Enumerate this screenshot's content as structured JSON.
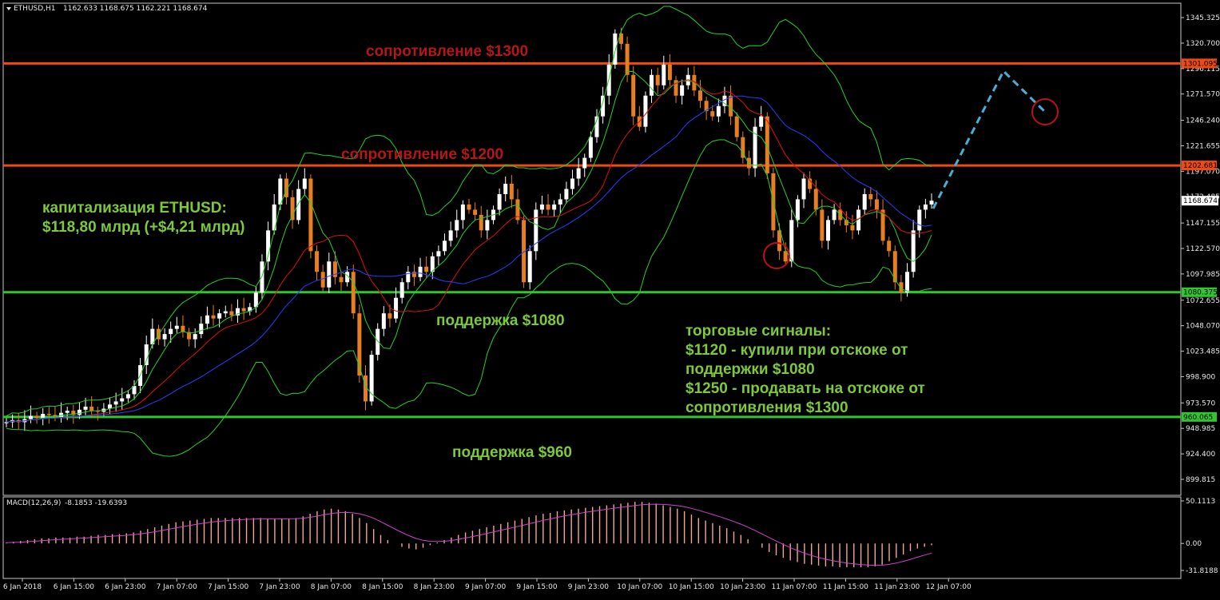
{
  "header": {
    "symbol": "ETHUSD,H1",
    "ohlc": "1162.633 1168.675 1162.221 1168.674",
    "macd_label": "MACD(12,26,9)",
    "macd_values": "-8.1853 -19.6393"
  },
  "colors": {
    "background": "#000000",
    "bull": "#ffffff",
    "bear": "#e67e22",
    "resistance": "#f04a0f",
    "support": "#31c531",
    "bollinger": "#22d322",
    "ma_fast": "#22d322",
    "ma_mid": "#e01010",
    "ma_slow": "#2a3cff",
    "projection": "#4aaed6",
    "macd_hist": "#f0a894",
    "macd_signal": "#d040d0"
  },
  "annotations": {
    "res1300": "сопротивление $1300",
    "res1200": "сопротивление $1200",
    "sup1080": "поддержка $1080",
    "sup960": "поддержка $960",
    "cap_line1": "капитализация ETHUSD:",
    "cap_line2": "$118,80 млрд (+$4,21 млрд)",
    "signals_title": "торговые сигналы:",
    "signal1_line1": "$1120 - купили при отскоке от",
    "signal1_line2": "поддержки $1080",
    "signal2_line1": "$1250 - продавать на отскоке от",
    "signal2_line2": "сопротивления $1300"
  },
  "chart_data": {
    "type": "candlestick",
    "title": "ETHUSD,H1",
    "y_ticks": [
      "1345.325",
      "1320.700",
      "1296.115",
      "1271.570",
      "1246.240",
      "1221.655",
      "1197.070",
      "1172.485",
      "1147.155",
      "1122.570",
      "1097.985",
      "1072.655",
      "1048.070",
      "1023.485",
      "998.900",
      "973.570",
      "948.985",
      "924.400",
      "899.815"
    ],
    "ylim": [
      899.815,
      1345.325
    ],
    "x_ticks": [
      "6 Jan 2018",
      "6 Jan 15:00",
      "6 Jan 23:00",
      "7 Jan 07:00",
      "7 Jan 15:00",
      "7 Jan 23:00",
      "8 Jan 07:00",
      "8 Jan 15:00",
      "8 Jan 23:00",
      "9 Jan 07:00",
      "9 Jan 15:00",
      "9 Jan 23:00",
      "10 Jan 07:00",
      "10 Jan 15:00",
      "10 Jan 23:00",
      "11 Jan 07:00",
      "11 Jan 15:00",
      "11 Jan 23:00",
      "12 Jan 07:00"
    ],
    "levels": [
      {
        "label": "1301.095",
        "value": 1301.095,
        "kind": "resistance"
      },
      {
        "label": "1202.681",
        "value": 1202.681,
        "kind": "resistance"
      },
      {
        "label": "1168.674",
        "value": 1168.674,
        "kind": "current"
      },
      {
        "label": "1080.375",
        "value": 1080.375,
        "kind": "support"
      },
      {
        "label": "960.065",
        "value": 960.065,
        "kind": "support"
      }
    ],
    "candles_close": [
      955,
      957,
      955,
      958,
      961,
      959,
      963,
      962,
      960,
      964,
      966,
      962,
      967,
      970,
      966,
      965,
      968,
      972,
      975,
      978,
      982,
      990,
      1010,
      1030,
      1045,
      1035,
      1040,
      1045,
      1048,
      1042,
      1035,
      1040,
      1050,
      1058,
      1055,
      1060,
      1062,
      1058,
      1065,
      1062,
      1066,
      1080,
      1110,
      1140,
      1165,
      1190,
      1172,
      1150,
      1180,
      1190,
      1120,
      1100,
      1085,
      1110,
      1095,
      1090,
      1100,
      1060,
      1000,
      975,
      1020,
      1045,
      1060,
      1055,
      1075,
      1090,
      1100,
      1095,
      1105,
      1100,
      1115,
      1120,
      1130,
      1140,
      1150,
      1165,
      1160,
      1155,
      1140,
      1150,
      1160,
      1175,
      1185,
      1170,
      1150,
      1090,
      1120,
      1160,
      1165,
      1160,
      1165,
      1170,
      1180,
      1190,
      1200,
      1210,
      1230,
      1250,
      1270,
      1300,
      1330,
      1320,
      1290,
      1250,
      1240,
      1270,
      1290,
      1280,
      1300,
      1285,
      1270,
      1280,
      1290,
      1275,
      1265,
      1255,
      1250,
      1260,
      1270,
      1250,
      1230,
      1210,
      1200,
      1240,
      1250,
      1195,
      1140,
      1120,
      1110,
      1150,
      1170,
      1190,
      1180,
      1160,
      1130,
      1150,
      1160,
      1150,
      1145,
      1140,
      1160,
      1175,
      1170,
      1160,
      1130,
      1120,
      1090,
      1080,
      1100,
      1140,
      1160,
      1165,
      1168.674
    ],
    "macd": {
      "ylim": [
        -31.8188,
        50.1113
      ],
      "y_ticks": [
        "50.1113",
        "0.00",
        "-31.8188"
      ],
      "series": [
        {
          "name": "MACD",
          "values": [
            1,
            2,
            3,
            4,
            5,
            6,
            6,
            7,
            7,
            7,
            8,
            8,
            9,
            10,
            10,
            11,
            11,
            12,
            13,
            15,
            17,
            19,
            21,
            23,
            25,
            26,
            27,
            28,
            29,
            30,
            30,
            30,
            30,
            30,
            30,
            30,
            30,
            29,
            29,
            29,
            29,
            30,
            32,
            35,
            38,
            40,
            41,
            40,
            38,
            35,
            30,
            24,
            17,
            10,
            4,
            0,
            -4,
            -6,
            -7,
            -5,
            -2,
            1,
            4,
            7,
            10,
            13,
            15,
            17,
            19,
            21,
            23,
            25,
            27,
            29,
            31,
            33,
            35,
            36,
            38,
            39,
            40,
            41,
            42,
            43,
            44,
            45,
            46,
            47,
            48,
            49,
            49,
            48,
            47,
            45,
            43,
            41,
            38,
            34,
            30,
            27,
            24,
            21,
            18,
            14,
            10,
            5,
            0,
            -5,
            -10,
            -14,
            -17,
            -20,
            -22,
            -24,
            -25,
            -26,
            -27,
            -27,
            -28,
            -28,
            -28,
            -28,
            -28,
            -27,
            -25,
            -21,
            -17,
            -13,
            -9,
            -6,
            -4,
            -2
          ]
        }
      ]
    }
  }
}
